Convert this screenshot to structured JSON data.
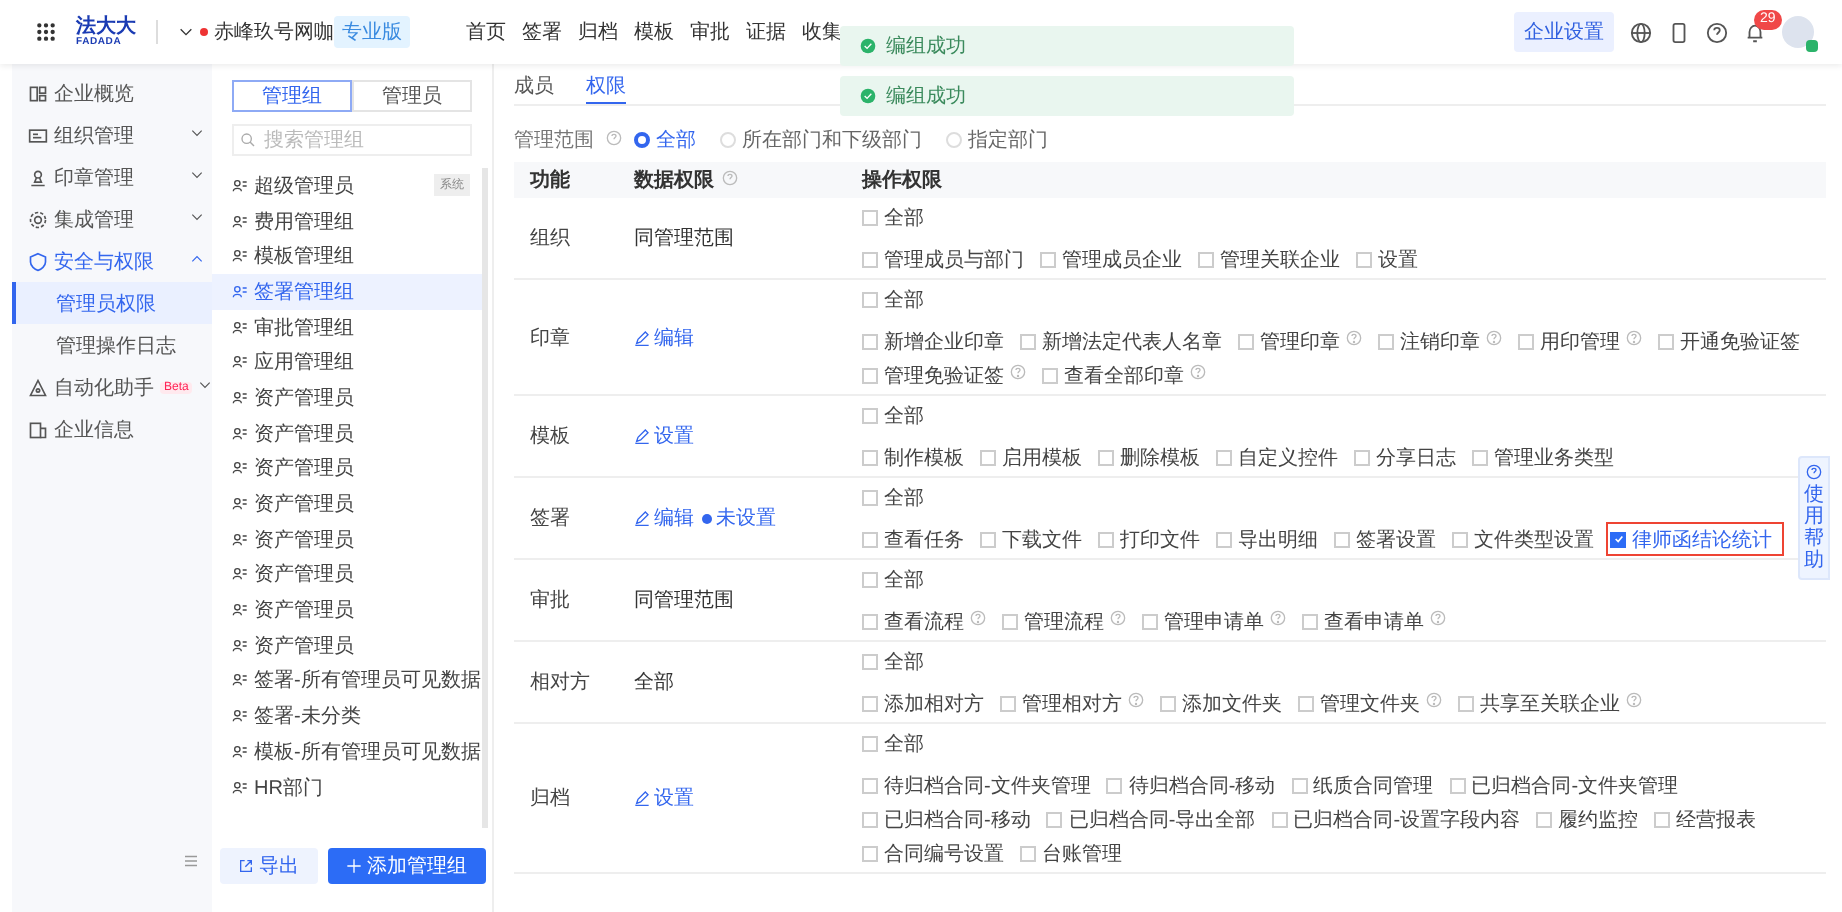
{
  "header": {
    "logo": {
      "title": "法大大",
      "subtitle": "FADADA"
    },
    "company": "赤峰玖号网咖",
    "edition": "专业版",
    "nav": [
      "首页",
      "签署",
      "归档",
      "模板",
      "审批",
      "证据",
      "收集"
    ],
    "settings_button": "企业设置",
    "notification_count": "29"
  },
  "toasts": [
    {
      "text": "编组成功"
    },
    {
      "text": "编组成功"
    }
  ],
  "sidebar": {
    "items": [
      {
        "label": "企业概览",
        "selected": false
      },
      {
        "label": "组织管理",
        "expanded": false,
        "selected": false
      },
      {
        "label": "印章管理",
        "expanded": false,
        "selected": false
      },
      {
        "label": "集成管理",
        "expanded": false,
        "selected": false
      },
      {
        "label": "安全与权限",
        "expanded": true,
        "selected": true,
        "children": [
          {
            "label": "管理员权限",
            "selected": true
          },
          {
            "label": "管理操作日志",
            "selected": false
          }
        ]
      },
      {
        "label": "自动化助手",
        "badge": "Beta",
        "expanded": false,
        "selected": false
      },
      {
        "label": "企业信息",
        "selected": false
      }
    ]
  },
  "group_panel": {
    "tabs": [
      {
        "label": "管理组",
        "selected": true
      },
      {
        "label": "管理员",
        "selected": false
      }
    ],
    "search": {
      "placeholder": "搜索管理组"
    },
    "groups": [
      {
        "name": "超级管理员",
        "tag": "系统",
        "selected": false
      },
      {
        "name": "费用管理组",
        "selected": false
      },
      {
        "name": "模板管理组",
        "selected": false
      },
      {
        "name": "签署管理组",
        "selected": true
      },
      {
        "name": "审批管理组",
        "selected": false
      },
      {
        "name": "应用管理组",
        "selected": false
      },
      {
        "name": "资产管理员",
        "selected": false
      },
      {
        "name": "资产管理员",
        "selected": false
      },
      {
        "name": "资产管理员",
        "selected": false
      },
      {
        "name": "资产管理员",
        "selected": false
      },
      {
        "name": "资产管理员",
        "selected": false
      },
      {
        "name": "资产管理员",
        "selected": false
      },
      {
        "name": "资产管理员",
        "selected": false
      },
      {
        "name": "资产管理员",
        "selected": false
      },
      {
        "name": "签署-所有管理员可见数据",
        "selected": false
      },
      {
        "name": "签署-未分类",
        "selected": false
      },
      {
        "name": "模板-所有管理员可见数据",
        "selected": false
      },
      {
        "name": "HR部门",
        "selected": false
      }
    ],
    "buttons": [
      {
        "label": "导出",
        "kind": "secondary"
      },
      {
        "label": "添加管理组",
        "kind": "primary"
      }
    ]
  },
  "detail": {
    "tabs": [
      {
        "label": "成员",
        "selected": false
      },
      {
        "label": "权限",
        "selected": true
      }
    ],
    "scope": {
      "label": "管理范围",
      "options": [
        {
          "label": "全部",
          "selected": true
        },
        {
          "label": "所在部门和下级部门",
          "selected": false
        },
        {
          "label": "指定部门",
          "selected": false
        }
      ]
    },
    "table": {
      "columns": [
        "功能",
        "数据权限",
        "操作权限"
      ],
      "rows": [
        {
          "function": "组织",
          "data": {
            "kind": "text",
            "text": "同管理范围"
          },
          "all": {
            "label": "全部",
            "checked": false
          },
          "options": [
            {
              "label": "管理成员与部门",
              "checked": false,
              "help": false
            },
            {
              "label": "管理成员企业",
              "checked": false,
              "help": false
            },
            {
              "label": "管理关联企业",
              "checked": false,
              "help": false
            },
            {
              "label": "设置",
              "checked": false,
              "help": false
            }
          ]
        },
        {
          "function": "印章",
          "data": {
            "kind": "link",
            "text": "编辑"
          },
          "all": {
            "label": "全部",
            "checked": false
          },
          "options": [
            {
              "label": "新增企业印章",
              "checked": false,
              "help": false
            },
            {
              "label": "新增法定代表人名章",
              "checked": false,
              "help": false
            },
            {
              "label": "管理印章",
              "checked": false,
              "help": true
            },
            {
              "label": "注销印章",
              "checked": false,
              "help": true
            },
            {
              "label": "用印管理",
              "checked": false,
              "help": true
            },
            {
              "label": "开通免验证签",
              "checked": false,
              "help": false
            },
            {
              "label": "管理免验证签",
              "checked": false,
              "help": true
            },
            {
              "label": "查看全部印章",
              "checked": false,
              "help": true
            }
          ]
        },
        {
          "function": "模板",
          "data": {
            "kind": "link",
            "text": "设置"
          },
          "all": {
            "label": "全部",
            "checked": false
          },
          "options": [
            {
              "label": "制作模板",
              "checked": false,
              "help": false
            },
            {
              "label": "启用模板",
              "checked": false,
              "help": false
            },
            {
              "label": "删除模板",
              "checked": false,
              "help": false
            },
            {
              "label": "自定义控件",
              "checked": false,
              "help": false
            },
            {
              "label": "分享日志",
              "checked": false,
              "help": false
            },
            {
              "label": "管理业务类型",
              "checked": false,
              "help": false
            }
          ]
        },
        {
          "function": "签署",
          "data": {
            "kind": "link",
            "text": "编辑",
            "status": "未设置"
          },
          "all": {
            "label": "全部",
            "checked": false
          },
          "options": [
            {
              "label": "查看任务",
              "checked": false,
              "help": false
            },
            {
              "label": "下载文件",
              "checked": false,
              "help": false
            },
            {
              "label": "打印文件",
              "checked": false,
              "help": false
            },
            {
              "label": "导出明细",
              "checked": false,
              "help": false
            },
            {
              "label": "签署设置",
              "checked": false,
              "help": false
            },
            {
              "label": "文件类型设置",
              "checked": false,
              "help": false
            },
            {
              "label": "律师函结论统计",
              "checked": true,
              "help": false,
              "highlighted": true
            }
          ]
        },
        {
          "function": "审批",
          "data": {
            "kind": "text",
            "text": "同管理范围"
          },
          "all": {
            "label": "全部",
            "checked": false
          },
          "options": [
            {
              "label": "查看流程",
              "checked": false,
              "help": true
            },
            {
              "label": "管理流程",
              "checked": false,
              "help": true
            },
            {
              "label": "管理申请单",
              "checked": false,
              "help": true
            },
            {
              "label": "查看申请单",
              "checked": false,
              "help": true
            }
          ]
        },
        {
          "function": "相对方",
          "data": {
            "kind": "text",
            "text": "全部"
          },
          "all": {
            "label": "全部",
            "checked": false
          },
          "options": [
            {
              "label": "添加相对方",
              "checked": false,
              "help": false
            },
            {
              "label": "管理相对方",
              "checked": false,
              "help": true
            },
            {
              "label": "添加文件夹",
              "checked": false,
              "help": false
            },
            {
              "label": "管理文件夹",
              "checked": false,
              "help": true
            },
            {
              "label": "共享至关联企业",
              "checked": false,
              "help": true
            }
          ]
        },
        {
          "function": "归档",
          "data": {
            "kind": "link",
            "text": "设置"
          },
          "all": {
            "label": "全部",
            "checked": false
          },
          "options": [
            {
              "label": "待归档合同-文件夹管理",
              "checked": false,
              "help": false
            },
            {
              "label": "待归档合同-移动",
              "checked": false,
              "help": false
            },
            {
              "label": "纸质合同管理",
              "checked": false,
              "help": false
            },
            {
              "label": "已归档合同-文件夹管理",
              "checked": false,
              "help": false
            },
            {
              "label": "已归档合同-移动",
              "checked": false,
              "help": false
            },
            {
              "label": "已归档合同-导出全部",
              "checked": false,
              "help": false
            },
            {
              "label": "已归档合同-设置字段内容",
              "checked": false,
              "help": false
            },
            {
              "label": "履约监控",
              "checked": false,
              "help": false
            },
            {
              "label": "经营报表",
              "checked": false,
              "help": false
            },
            {
              "label": "合同编号设置",
              "checked": false,
              "help": false
            },
            {
              "label": "台账管理",
              "checked": false,
              "help": false
            }
          ]
        }
      ]
    }
  },
  "help_tab": {
    "label": "使用帮助"
  }
}
